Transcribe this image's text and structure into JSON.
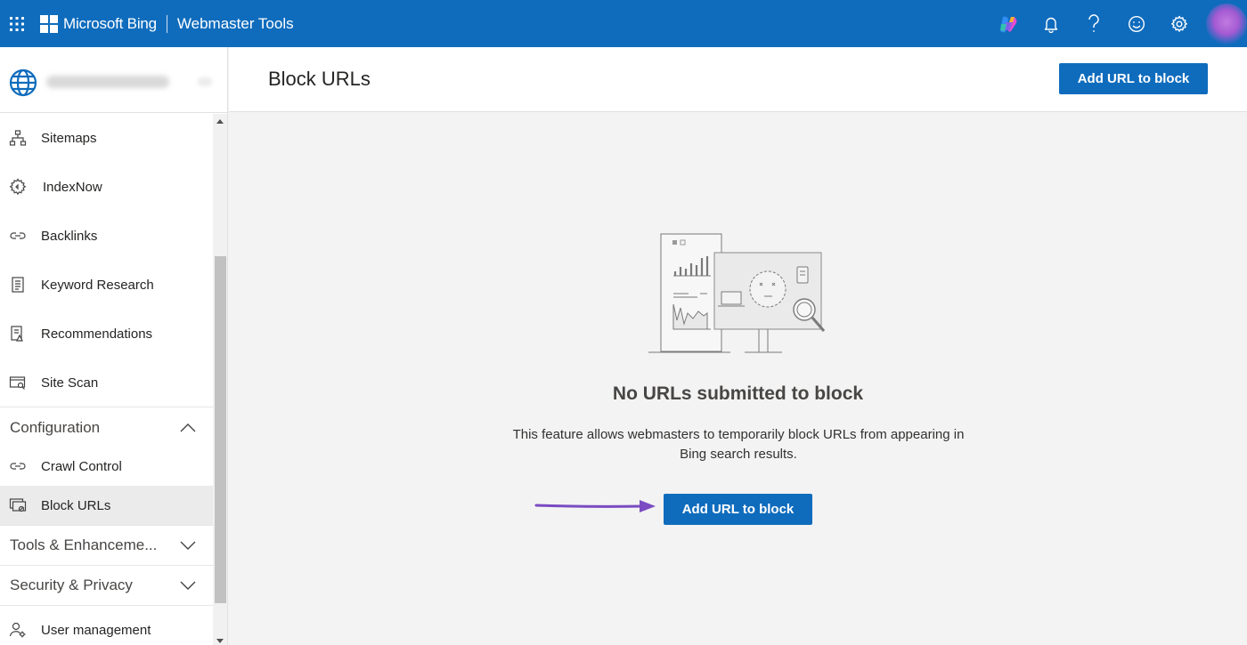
{
  "topbar": {
    "brand_name": "Microsoft Bing",
    "product_name": "Webmaster Tools",
    "icons": [
      "app-launcher-icon",
      "copilot-icon",
      "bell-icon",
      "help-icon",
      "feedback-smiley-icon",
      "gear-icon"
    ],
    "bg_color": "#0f6cbd"
  },
  "sidebar": {
    "items_top": [
      {
        "label": "Sitemaps",
        "icon": "sitemap-icon"
      },
      {
        "label": "IndexNow",
        "icon": "indexnow-gear-icon"
      },
      {
        "label": "Backlinks",
        "icon": "link-icon"
      },
      {
        "label": "Keyword Research",
        "icon": "document-icon"
      },
      {
        "label": "Recommendations",
        "icon": "recommendations-icon"
      },
      {
        "label": "Site Scan",
        "icon": "site-scan-icon"
      }
    ],
    "configuration": {
      "label": "Configuration",
      "items": [
        {
          "label": "Crawl Control",
          "icon": "link-icon"
        },
        {
          "label": "Block URLs",
          "icon": "block-urls-icon"
        }
      ]
    },
    "tools_group": "Tools & Enhanceme...",
    "security_group": "Security & Privacy",
    "user_management": "User management"
  },
  "main": {
    "title": "Block URLs",
    "header_button": "Add URL to block",
    "empty_title": "No URLs submitted to block",
    "empty_description": "This feature allows webmasters to temporarily block URLs from appearing in Bing search results.",
    "center_button": "Add URL to block",
    "primary_color": "#0f6cbd",
    "arrow_color": "#7a4bc2"
  }
}
